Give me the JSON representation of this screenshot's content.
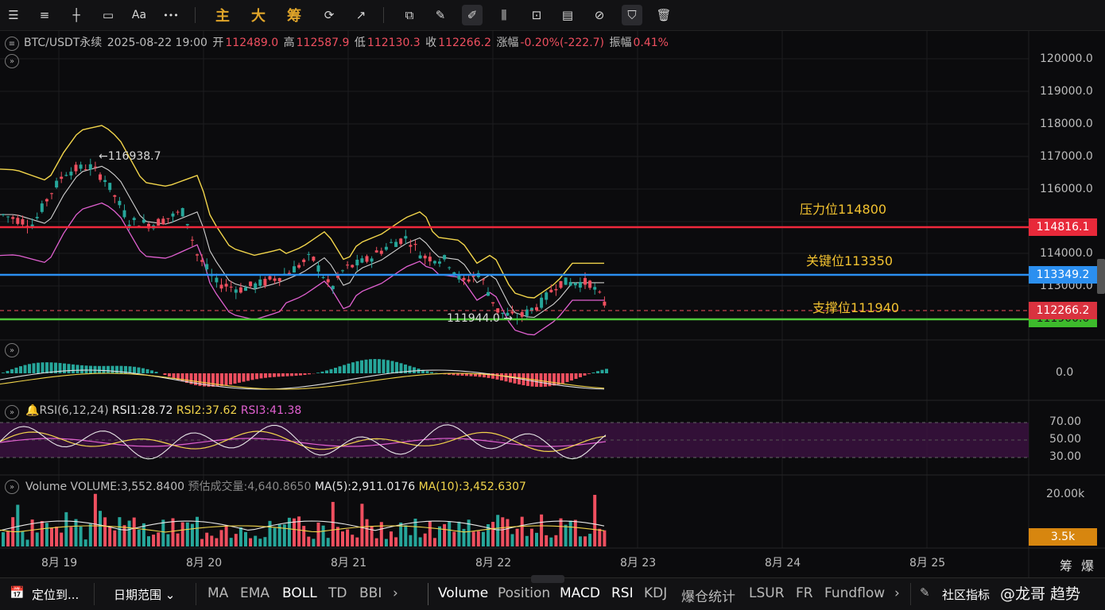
{
  "toolbar": {
    "zhu": "主",
    "da": "大",
    "chou": "筹",
    "aa": "Aa",
    "more": "•••"
  },
  "header": {
    "symbol": "BTC/USDT永续",
    "datetime": "2025-08-22 19:00",
    "open_label": "开",
    "open": "112489.0",
    "high_label": "高",
    "high": "112587.9",
    "low_label": "低",
    "low": "112130.3",
    "close_label": "收",
    "close": "112266.2",
    "change_label": "涨幅",
    "change": "-0.20%(-222.7)",
    "amp_label": "振幅",
    "amp": "0.41%"
  },
  "price_axis": [
    "120000.0",
    "119000.0",
    "118000.0",
    "117000.0",
    "116000.0",
    "114000.0",
    "113000.0"
  ],
  "price_tags": {
    "resistance": "114816.1",
    "key": "113349.2",
    "last": "112266.2",
    "support": "111900.0"
  },
  "annotations": {
    "resistance": "压力位114800",
    "key": "关键位113350",
    "support": "支撑位111940",
    "high_mark": "116938.7",
    "low_mark": "111944.0"
  },
  "macd": {
    "zero": "0.0"
  },
  "rsi": {
    "label": "RSI(6,12,24)",
    "rsi1": "RSI1:28.72",
    "rsi2": "RSI2:37.62",
    "rsi3": "RSI3:41.38",
    "levels": [
      "70.00",
      "50.00",
      "30.00"
    ]
  },
  "volume": {
    "label": "Volume",
    "vol": "VOLUME:3,552.8400",
    "est": "预估成交量:4,640.8650",
    "ma5": "MA(5):2,911.0176",
    "ma10": "MA(10):3,452.6307",
    "axis": "20.00k",
    "tag": "3.5k"
  },
  "time_axis": [
    "8月 19",
    "8月 20",
    "8月 21",
    "8月 22",
    "8月 23",
    "8月 24",
    "8月 25"
  ],
  "right_corner": [
    "筹",
    "爆"
  ],
  "bottom": {
    "locate": "定位到...",
    "range": "日期范围",
    "main_ind": [
      "MA",
      "EMA",
      "BOLL",
      "TD",
      "BBI"
    ],
    "sub_ind": [
      "Volume",
      "Position",
      "MACD",
      "RSI",
      "KDJ",
      "爆仓统计",
      "LSUR",
      "FR",
      "Fundflow"
    ],
    "community": "社区指标",
    "watermark": "@龙哥 趋势"
  },
  "colors": {
    "up": "#26a69a",
    "down": "#ef4f5f",
    "resistance": "#f0283c",
    "key": "#2b8ff0",
    "support": "#4fc93a",
    "boll_outer": "#f2d54b",
    "boll_mid": "#d0d0d0",
    "boll_low": "#e060d0"
  }
}
